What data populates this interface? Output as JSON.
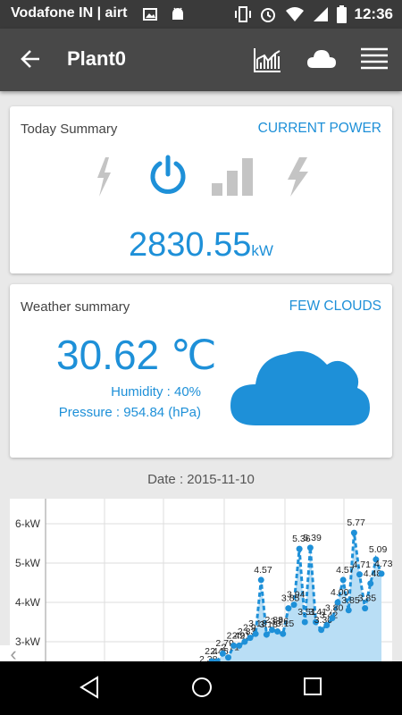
{
  "status_bar": {
    "carrier": "Vodafone IN | airt",
    "time": "12:36"
  },
  "app_bar": {
    "title": "Plant0",
    "actions": [
      "chart-icon",
      "cloud-icon",
      "menu-icon"
    ]
  },
  "today_summary": {
    "title": "Today Summary",
    "status": "CURRENT POWER",
    "value": "2830.55",
    "unit": "kW",
    "icons": [
      "flash-icon",
      "power-icon",
      "signal-icon",
      "flash-auto-icon"
    ],
    "accent_color": "#1e90d8"
  },
  "weather": {
    "title": "Weather summary",
    "condition": "FEW CLOUDS",
    "temperature": "30.62 ℃",
    "humidity": "Humidity : 40%",
    "pressure": "Pressure : 954.84 (hPa)",
    "icon": "cloud-icon"
  },
  "date_label": "Date : 2015-11-10",
  "chart_data": {
    "type": "area",
    "ylabels": [
      "6-kW",
      "5-kW",
      "4-kW",
      "3-kW"
    ],
    "grid": true,
    "series": [
      {
        "values": [
          2.3,
          2.5,
          2.5,
          2.7,
          2.6,
          2.9,
          2.9,
          3.0,
          3.1,
          3.2,
          4.57,
          3.18,
          3.3,
          3.26,
          3.2,
          3.85,
          3.94,
          5.36,
          3.5,
          5.39,
          3.5,
          3.3,
          3.42,
          3.6,
          4.0,
          4.57,
          3.8,
          5.77,
          4.71,
          3.85,
          4.48,
          5.09,
          4.73
        ]
      }
    ],
    "point_labels": [
      "2.38",
      "2.4",
      "2.45",
      "2.79",
      "2.71",
      "2.42",
      "2.91",
      "2.83",
      "2.9",
      "3.18",
      "4.57",
      "3.18",
      "2.88",
      "3.26",
      "3.15",
      "3.85",
      "3.94",
      "5.36",
      "3.51",
      "5.39",
      "3.41",
      "3.30",
      "3.42",
      "3.80",
      "4.00",
      "4.57",
      "3.85",
      "5.77",
      "4.71",
      "3.85",
      "4.48",
      "5.09",
      "4.73"
    ],
    "colors": {
      "line": "#1e90d8",
      "fill": "#b9def5"
    }
  },
  "nav_bar": {
    "buttons": [
      "back-icon",
      "home-icon",
      "recents-icon"
    ]
  }
}
